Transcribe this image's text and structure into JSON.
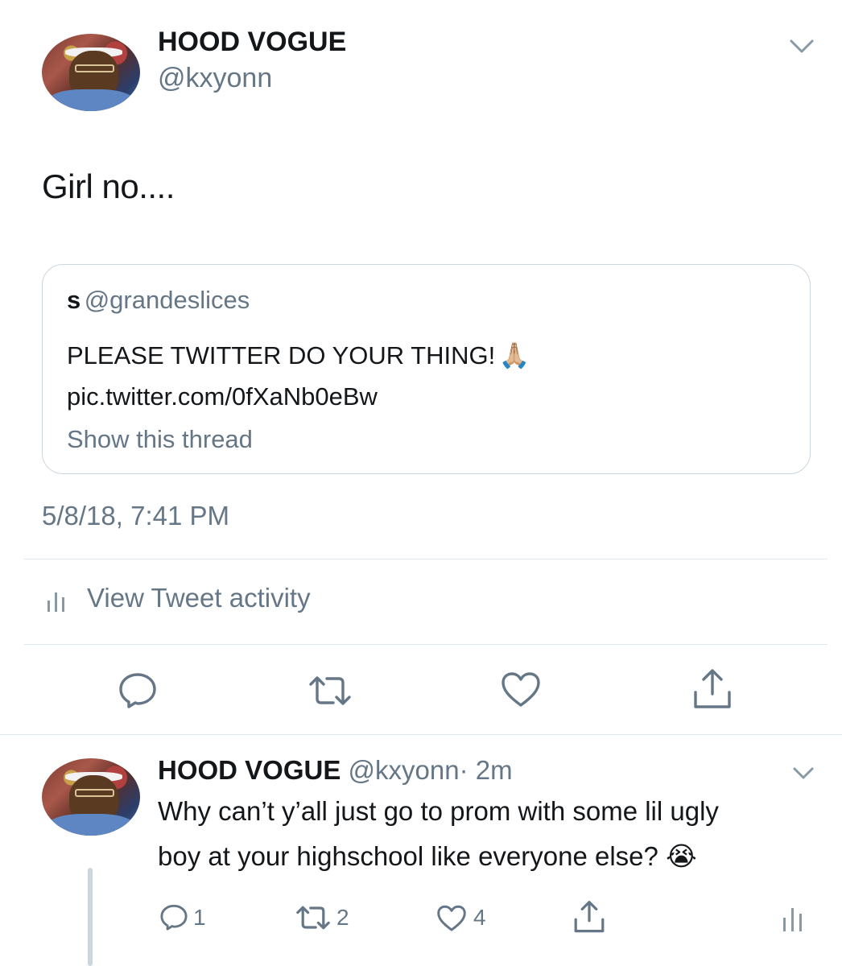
{
  "main_tweet": {
    "display_name": "HOOD VOGUE",
    "handle": "@kxyonn",
    "text": "Girl no....",
    "quoted": {
      "display_name": "s",
      "handle": "@grandeslices",
      "text": "PLEASE TWITTER DO YOUR THING!",
      "emoji": "🙏🏼",
      "link": "pic.twitter.com/0fXaNb0eBw",
      "show_thread": "Show this thread"
    },
    "timestamp": "5/8/18, 7:41 PM",
    "activity_label": "View Tweet activity"
  },
  "reply": {
    "display_name": "HOOD VOGUE",
    "handle": "@kxyonn",
    "separator": "·",
    "time": "2m",
    "text_line1": "Why can’t y’all just go to prom with some lil ugly",
    "text_line2": "boy at your highschool like everyone else?",
    "emoji": "😭",
    "reply_count": "1",
    "retweet_count": "2",
    "like_count": "4"
  },
  "colors": {
    "text": "#14171a",
    "secondary": "#657786",
    "divider": "#e1e8ed",
    "icon": "#657786"
  },
  "icons": [
    "chevron-down-icon",
    "reply-icon",
    "retweet-icon",
    "like-icon",
    "share-icon",
    "analytics-icon"
  ]
}
